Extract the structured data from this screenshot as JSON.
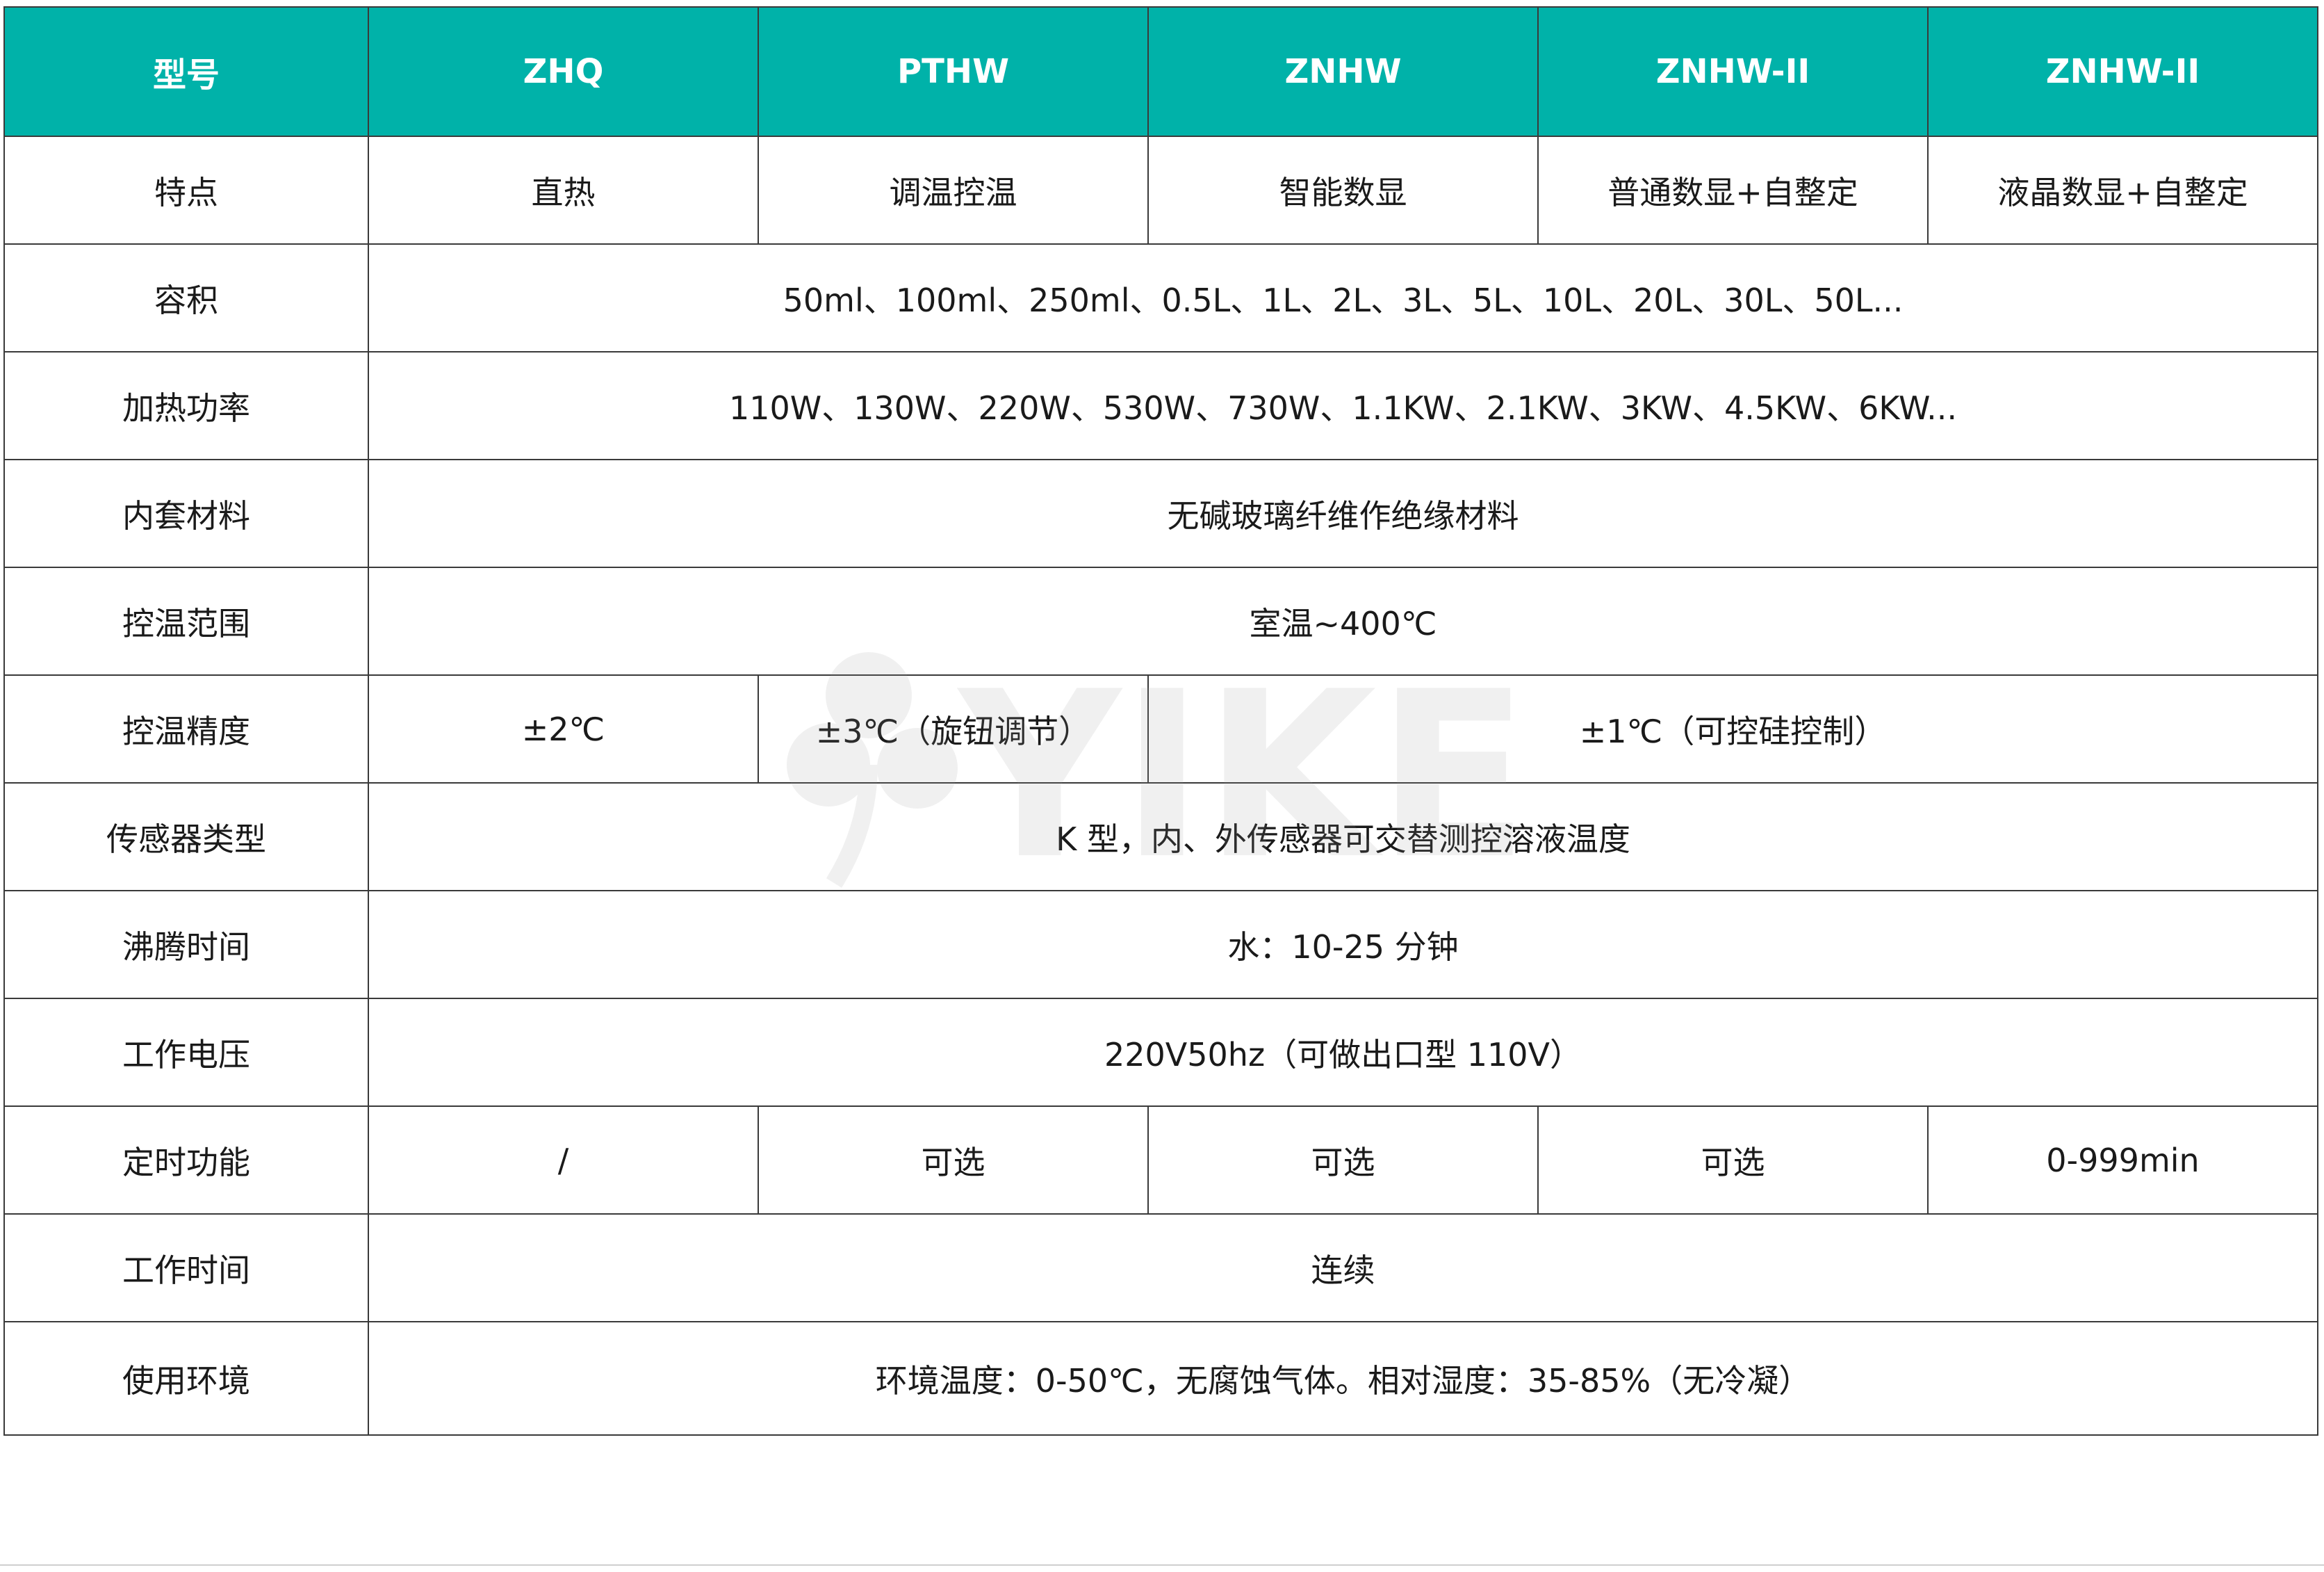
{
  "table": {
    "header": [
      "型号",
      "ZHQ",
      "PTHW",
      "ZNHW",
      "ZNHW-II",
      "ZNHW-II"
    ],
    "rows": {
      "features": {
        "label": "特点",
        "values": [
          "直热",
          "调温控温",
          "智能数显",
          "普通数显+自整定",
          "液晶数显+自整定"
        ]
      },
      "capacity": {
        "label": "容积",
        "value": "50ml、100ml、250ml、0.5L、1L、2L、3L、5L、10L、20L、30L、50L..."
      },
      "power": {
        "label": "加热功率",
        "value": "110W、130W、220W、530W、730W、1.1KW、2.1KW、3KW、4.5KW、6KW..."
      },
      "liner": {
        "label": "内套材料",
        "value": "无碱玻璃纤维作绝缘材料"
      },
      "temp_range": {
        "label": "控温范围",
        "value": "室温~400℃"
      },
      "precision": {
        "label": "控温精度",
        "values": [
          "±2℃",
          "±3℃（旋钮调节）",
          "±1℃（可控硅控制）"
        ]
      },
      "sensor": {
        "label": "传感器类型",
        "value": "K 型，内、外传感器可交替测控溶液温度"
      },
      "boil_time": {
        "label": "沸腾时间",
        "value": "水：10-25 分钟"
      },
      "voltage": {
        "label": "工作电压",
        "value": "220V50hz（可做出口型 110V）"
      },
      "timer": {
        "label": "定时功能",
        "values": [
          "/",
          "可选",
          "可选",
          "可选",
          "0-999min"
        ]
      },
      "work_time": {
        "label": "工作时间",
        "value": "连续"
      },
      "environment": {
        "label": "使用环境",
        "value": "环境温度：0-50℃，无腐蚀气体。相对湿度：35-85%（无冷凝）"
      }
    }
  },
  "watermark": {
    "text": "YIKE",
    "icon": "clover-leaf-icon",
    "color": "#9a9a9a"
  },
  "colors": {
    "header_bg": "#00b2a9",
    "header_text": "#ffffff",
    "border": "#3a3a3a"
  }
}
